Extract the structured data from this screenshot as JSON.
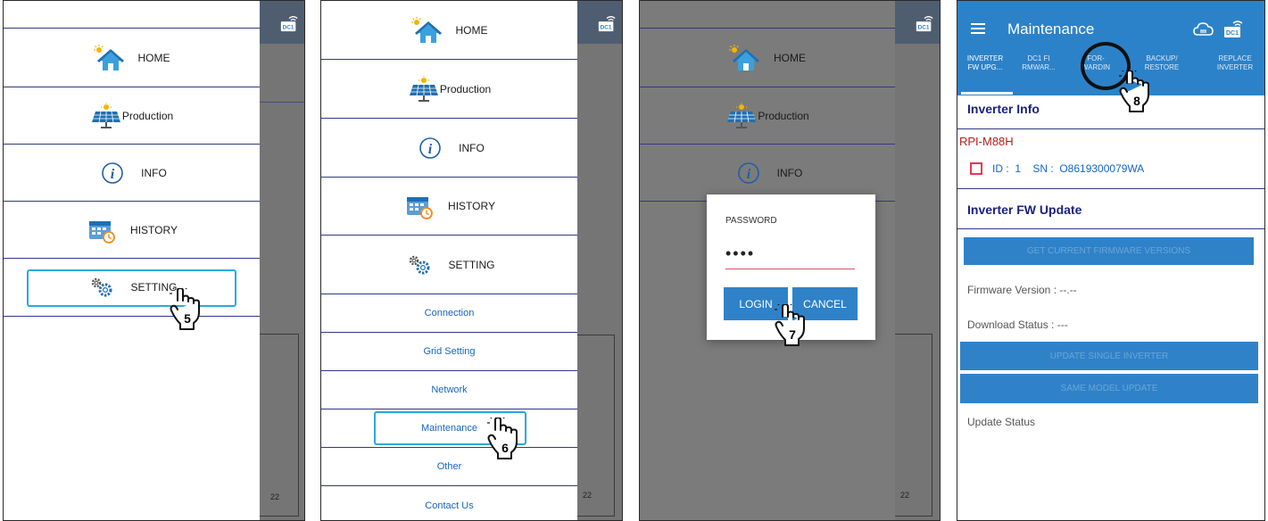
{
  "panel1": {
    "menu": [
      "HOME",
      "Production",
      "INFO",
      "HISTORY",
      "SETTING"
    ],
    "step": "5"
  },
  "panel2": {
    "menu": [
      "HOME",
      "Production",
      "INFO",
      "HISTORY",
      "SETTING"
    ],
    "submenu": [
      "Connection",
      "Grid Setting",
      "Network",
      "Maintenance",
      "Other",
      "Contact Us"
    ],
    "step": "6",
    "bg_tick": "22"
  },
  "panel3": {
    "menu": [
      "HOME",
      "Production",
      "INFO"
    ],
    "dialog": {
      "title": "PASSWORD",
      "value": "••••",
      "login": "LOGIN",
      "cancel": "CANCEL"
    },
    "step": "7",
    "bg_tick": "22"
  },
  "panel4": {
    "title": "Maintenance",
    "tabs": [
      [
        "INVERTER",
        "FW UPG..."
      ],
      [
        "DC1 FI",
        "RMWAR..."
      ],
      [
        "FOR-",
        "WARDIN"
      ],
      [
        "BACKUP/",
        "RESTORE"
      ],
      [
        "REPLACE",
        "INVERTER"
      ]
    ],
    "inverter_info_title": "Inverter Info",
    "model": "RPI-M88H",
    "id_line": "ID :  1    SN :  O8619300079WA",
    "fw_update_title": "Inverter FW Update",
    "get_versions": "GET CURRENT FIRMWARE VERSIONS",
    "firmware_version": "Firmware Version :  --.--",
    "download_status": "Download Status :  ---",
    "update_single": "UPDATE SINGLE INVERTER",
    "same_model": "SAME MODEL UPDATE",
    "update_status": "Update Status",
    "step": "8"
  },
  "colors": {
    "accent_blue": "#2c82c9",
    "menu_line": "#2e3a80",
    "highlight": "#29a9e0",
    "model_red": "#b71c1c",
    "checkbox_red": "#e53950"
  },
  "bg_tick_p1": "22"
}
